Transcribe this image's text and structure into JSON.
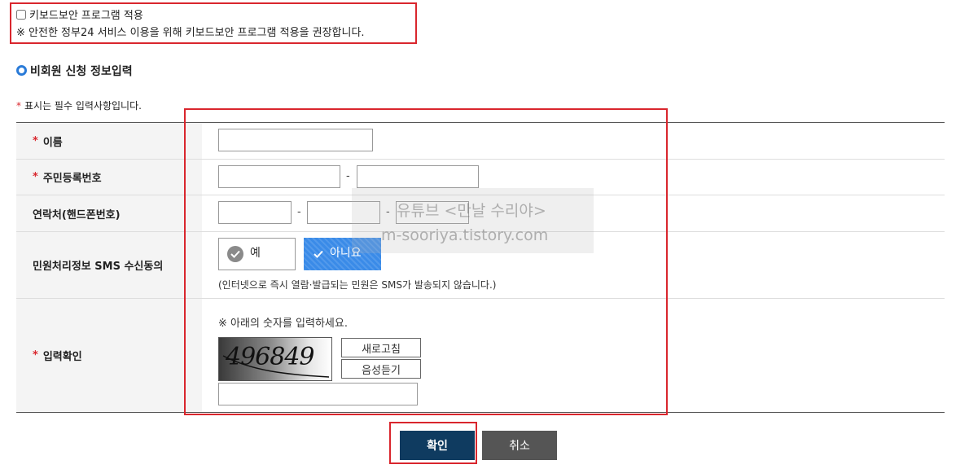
{
  "keyboard_security": {
    "checkbox_label": "키보드보안 프로그램 적용",
    "notice": "※ 안전한 정부24 서비스 이용을 위해 키보드보안 프로그램 적용을 권장합니다."
  },
  "section": {
    "title": "비회원 신청 정보입력",
    "required_note": "표시는 필수 입력사항입니다.",
    "required_mark": "*"
  },
  "form": {
    "name_label": "이름",
    "rrn_label": "주민등록번호",
    "phone_label": "연락처(핸드폰번호)",
    "sms_label": "민원처리정보 SMS 수신동의",
    "verify_label": "입력확인",
    "separator": "-",
    "sms_yes": "예",
    "sms_no": "아니요",
    "sms_note": "(인터넷으로 즉시 열람·발급되는 민원은 SMS가 발송되지 않습니다.)",
    "captcha_instruction": "※ 아래의 숫자를 입력하세요.",
    "captcha_text": "496849",
    "refresh_button": "새로고침",
    "audio_button": "음성듣기"
  },
  "watermark": {
    "line1": "유튜브 <만날 수리야>",
    "line2": "m-sooriya.tistory.com"
  },
  "actions": {
    "confirm": "확인",
    "cancel": "취소"
  },
  "colors": {
    "highlight_border": "#d9262d",
    "primary_button": "#0f3b60",
    "secondary_button": "#555555",
    "selected_option": "#3a8be8"
  }
}
